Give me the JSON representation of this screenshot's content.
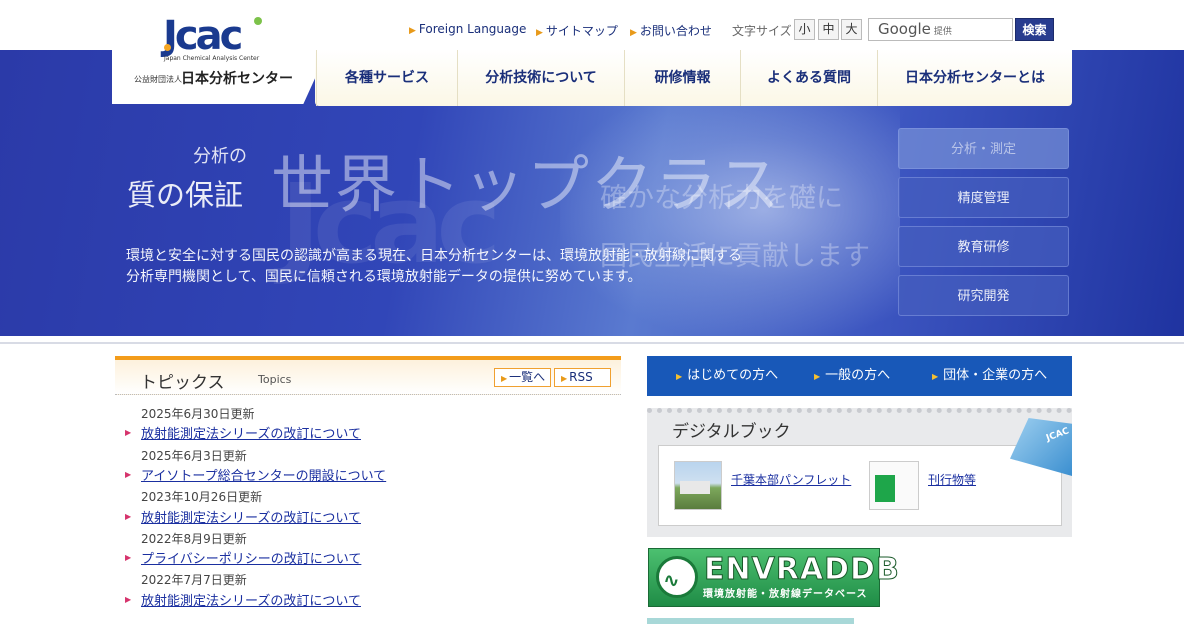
{
  "logo": {
    "mark": "Jcac",
    "english_name": "Japan Chemical Analysis Center",
    "org_type": "公益財団法人",
    "japanese_name": "日本分析センター"
  },
  "utility_links": [
    {
      "label": "Foreign Language"
    },
    {
      "label": "サイトマップ"
    },
    {
      "label": "お問い合わせ"
    }
  ],
  "font_size": {
    "label": "文字サイズ",
    "options": [
      "小",
      "中",
      "大"
    ]
  },
  "search": {
    "provider_brand": "Google",
    "provider_suffix": "提供",
    "button_label": "検索"
  },
  "nav": {
    "items": [
      "各種サービス",
      "分析技術について",
      "研修情報",
      "よくある質問",
      "日本分析センターとは"
    ]
  },
  "hero": {
    "small_line1": "分析の",
    "small_line2": "質の保証",
    "headline": "世界トップクラス",
    "sub_line1": "確かな分析力を礎に",
    "sub_line2": "国民生活に貢献します",
    "description_line1": "環境と安全に対する国民の認識が高まる現在、日本分析センターは、環境放射能・放射線に関する",
    "description_line2": "分析専門機関として、国民に信頼される環境放射能データの提供に努めています。",
    "side_buttons": [
      "分析・測定",
      "精度管理",
      "教育研修",
      "研究開発"
    ]
  },
  "topics": {
    "title": "トピックス",
    "subtitle": "Topics",
    "list_button": "一覧へ",
    "rss_button": "RSS",
    "items": [
      {
        "date": "2025年6月30日更新",
        "title": "放射能測定法シリーズの改訂について"
      },
      {
        "date": "2025年6月3日更新",
        "title": "アイソトープ総合センターの開設について"
      },
      {
        "date": "2023年10月26日更新",
        "title": "放射能測定法シリーズの改訂について"
      },
      {
        "date": "2022年8月9日更新",
        "title": "プライバシーポリシーの改訂について"
      },
      {
        "date": "2022年7月7日更新",
        "title": "放射能測定法シリーズの改訂について"
      }
    ]
  },
  "audience_links": [
    "はじめての方へ",
    "一般の方へ",
    "団体・企業の方へ"
  ],
  "digital_book": {
    "title": "デジタルブック",
    "badge": "JCAC",
    "items": [
      {
        "label": "千葉本部パンフレット"
      },
      {
        "label": "刊行物等"
      }
    ]
  },
  "envraddb": {
    "title": "ENVRADDB",
    "subtitle": "環境放射能・放射線データベース"
  },
  "colors": {
    "brand_blue": "#1a2f7a",
    "accent_orange": "#f39c1a",
    "audience_blue": "#1858b8",
    "envraddb_green": "#1f8c46"
  }
}
